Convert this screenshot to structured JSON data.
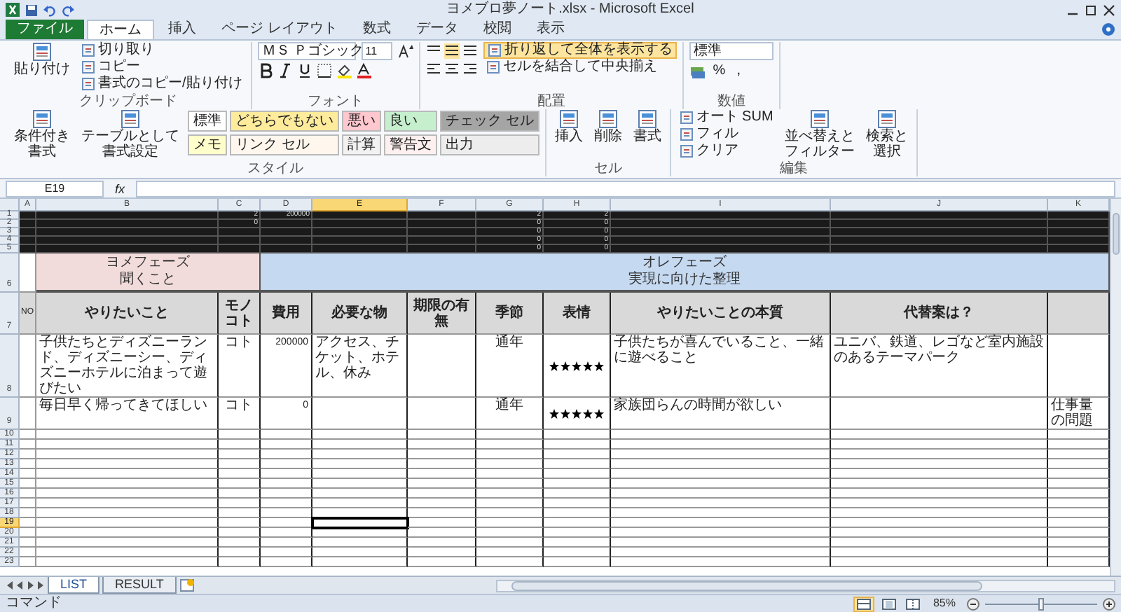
{
  "window": {
    "title": "ヨメブロ夢ノート.xlsx - Microsoft Excel"
  },
  "ribbon_tabs": [
    {
      "label": "ファイル",
      "kind": "file",
      "selected": false
    },
    {
      "label": "ホーム",
      "kind": "tab",
      "selected": true
    },
    {
      "label": "挿入",
      "kind": "tab",
      "selected": false
    },
    {
      "label": "ページ レイアウト",
      "kind": "tab",
      "selected": false
    },
    {
      "label": "数式",
      "kind": "tab",
      "selected": false
    },
    {
      "label": "データ",
      "kind": "tab",
      "selected": false
    },
    {
      "label": "校閲",
      "kind": "tab",
      "selected": false
    },
    {
      "label": "表示",
      "kind": "tab",
      "selected": false
    }
  ],
  "ribbon_groups": [
    {
      "label": "クリップボード",
      "columns": [
        {
          "kind": "large",
          "lines": [
            "貼り付け"
          ]
        },
        {
          "kind": "stack",
          "items": [
            {
              "label": "切り取り",
              "active": false
            },
            {
              "label": "コピー",
              "active": false
            },
            {
              "label": "書式のコピー/貼り付け",
              "active": false
            }
          ]
        }
      ]
    },
    {
      "label": "フォント",
      "columns": [
        {
          "kind": "font",
          "font": "ＭＳ Ｐゴシック",
          "size": "11"
        }
      ]
    },
    {
      "label": "配置",
      "columns": [
        {
          "kind": "align_icons"
        },
        {
          "kind": "stack",
          "items": [
            {
              "label": "折り返して全体を表示する",
              "active": true
            },
            {
              "label": "セルを結合して中央揃え",
              "active": false
            }
          ]
        }
      ]
    },
    {
      "label": "数値",
      "columns": [
        {
          "kind": "number",
          "format": "標準",
          "symbols": [
            "%",
            ","
          ]
        }
      ]
    },
    {
      "label": "スタイル",
      "columns": [
        {
          "kind": "large",
          "lines": [
            "条件付き",
            "書式"
          ]
        },
        {
          "kind": "large",
          "lines": [
            "テーブルとして",
            "書式設定"
          ]
        },
        {
          "kind": "gallery",
          "styles": [
            {
              "label": "標準",
              "color": "#ffffff"
            },
            {
              "label": "どちらでもない",
              "color": "#ffeb9c"
            },
            {
              "label": "悪い",
              "color": "#ffc7ce"
            },
            {
              "label": "良い",
              "color": "#c6efce"
            },
            {
              "label": "チェック セル",
              "color": "#a5a5a5"
            },
            {
              "label": "メモ",
              "color": "#ffffcc"
            },
            {
              "label": "リンク セル",
              "color": "#fff7ee"
            },
            {
              "label": "計算",
              "color": "#f2f2f2"
            },
            {
              "label": "警告文",
              "color": "#fff0f0"
            },
            {
              "label": "出力",
              "color": "#ededed"
            }
          ]
        }
      ]
    },
    {
      "label": "セル",
      "columns": [
        {
          "kind": "large",
          "lines": [
            "挿入"
          ]
        },
        {
          "kind": "large",
          "lines": [
            "削除"
          ]
        },
        {
          "kind": "large",
          "lines": [
            "書式"
          ]
        }
      ]
    },
    {
      "label": "編集",
      "columns": [
        {
          "kind": "stack",
          "items": [
            {
              "label": "オート SUM",
              "active": false
            },
            {
              "label": "フィル",
              "active": false
            },
            {
              "label": "クリア",
              "active": false
            }
          ]
        },
        {
          "kind": "large",
          "lines": [
            "並べ替えと",
            "フィルター"
          ]
        },
        {
          "kind": "large",
          "lines": [
            "検索と",
            "選択"
          ]
        }
      ]
    }
  ],
  "formula_bar": {
    "name_box": "E19",
    "function_label": "fx"
  },
  "columns": [
    {
      "label": "A",
      "selected": false
    },
    {
      "label": "B",
      "selected": false
    },
    {
      "label": "C",
      "selected": false
    },
    {
      "label": "D",
      "selected": false
    },
    {
      "label": "E",
      "selected": true
    },
    {
      "label": "F",
      "selected": false
    },
    {
      "label": "G",
      "selected": false
    },
    {
      "label": "H",
      "selected": false
    },
    {
      "label": "I",
      "selected": false
    },
    {
      "label": "J",
      "selected": false
    },
    {
      "label": "K",
      "selected": false
    }
  ],
  "rows": [
    {
      "number": "1",
      "kind": "dark",
      "selected": false,
      "cells": {
        "C": "2",
        "D": "200000",
        "G": "2",
        "H": "2"
      }
    },
    {
      "number": "2",
      "kind": "dark",
      "selected": false,
      "cells": {
        "C": "0",
        "G": "0",
        "H": "0"
      }
    },
    {
      "number": "3",
      "kind": "dark",
      "selected": false,
      "cells": {
        "G": "0",
        "H": "0"
      }
    },
    {
      "number": "4",
      "kind": "dark",
      "selected": false,
      "cells": {
        "G": "0",
        "H": "0"
      }
    },
    {
      "number": "5",
      "kind": "dark",
      "selected": false,
      "cells": {
        "G": "0",
        "H": "0"
      }
    },
    {
      "number": "6",
      "kind": "phase",
      "selected": false,
      "phases": [
        {
          "lines": [
            "ヨメフェーズ",
            "聞くこと"
          ],
          "color": "#f2dcdb"
        },
        {
          "lines": [
            "オレフェーズ",
            "実現に向けた整理"
          ],
          "color": "#c5d9f1"
        }
      ]
    },
    {
      "number": "7",
      "kind": "header",
      "selected": false,
      "cells": {
        "A": "NO",
        "B": "やりたいこと",
        "C": "モノコト",
        "D": "費用",
        "E": "必要な物",
        "F": "期限の有無",
        "G": "季節",
        "H": "表情",
        "I": "やりたいことの本質",
        "J": "代替案は？"
      }
    },
    {
      "number": "8",
      "kind": "data",
      "selected": false,
      "cells": {
        "B": "子供たちとディズニーランド、ディズニーシー、ディズニーホテルに泊まって遊びたい",
        "C": "コト",
        "D": "200000",
        "E": "アクセス、チケット、ホテル、休み",
        "G": "通年",
        "H": {
          "stars": 5
        },
        "I": "子供たちが喜んでいること、一緒に遊べること",
        "J": "ユニバ、鉄道、レゴなど室内施設のあるテーマパーク"
      }
    },
    {
      "number": "9",
      "kind": "data",
      "selected": false,
      "cells": {
        "B": "毎日早く帰ってきてほしい",
        "C": "コト",
        "D": "0",
        "G": "通年",
        "H": {
          "stars": 5
        },
        "I": "家族団らんの時間が欲しい",
        "K": "仕事量の問題"
      }
    },
    {
      "number": "10",
      "kind": "blank",
      "selected": false
    },
    {
      "number": "11",
      "kind": "blank",
      "selected": false
    },
    {
      "number": "12",
      "kind": "blank",
      "selected": false
    },
    {
      "number": "13",
      "kind": "blank",
      "selected": false
    },
    {
      "number": "14",
      "kind": "blank",
      "selected": false
    },
    {
      "number": "15",
      "kind": "blank",
      "selected": false
    },
    {
      "number": "16",
      "kind": "blank",
      "selected": false
    },
    {
      "number": "17",
      "kind": "blank",
      "selected": false
    },
    {
      "number": "18",
      "kind": "blank",
      "selected": false
    },
    {
      "number": "19",
      "kind": "blank",
      "selected": true
    },
    {
      "number": "20",
      "kind": "blank",
      "selected": false
    },
    {
      "number": "21",
      "kind": "blank",
      "selected": false
    },
    {
      "number": "22",
      "kind": "blank",
      "selected": false
    },
    {
      "number": "23",
      "kind": "blank",
      "selected": false
    }
  ],
  "sheet_tabs": [
    {
      "label": "LIST",
      "selected": true
    },
    {
      "label": "RESULT",
      "selected": false
    }
  ],
  "status_bar": {
    "mode": "コマンド",
    "views": [
      {
        "kind": "normal",
        "selected": true
      },
      {
        "kind": "page_layout",
        "selected": false
      },
      {
        "kind": "page_break",
        "selected": false
      }
    ],
    "zoom": "85%",
    "zoom_slider": {
      "level": 0.5
    }
  }
}
